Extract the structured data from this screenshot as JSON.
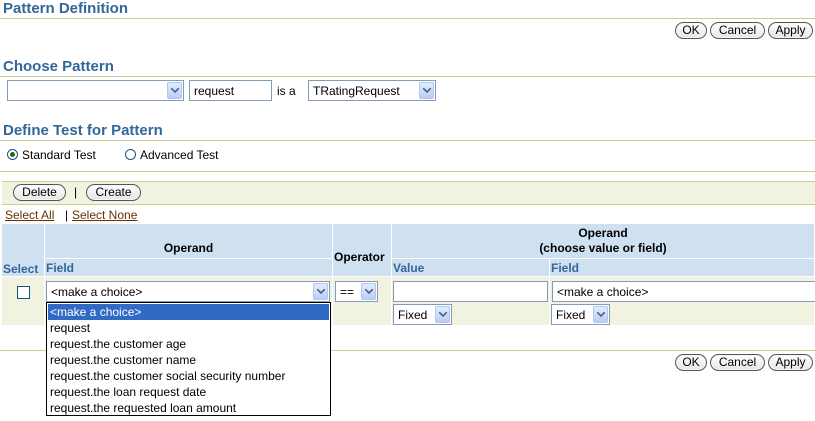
{
  "page_title": "Pattern Definition",
  "actions": {
    "ok": "OK",
    "cancel": "Cancel",
    "apply": "Apply"
  },
  "choose_pattern": {
    "heading": "Choose Pattern",
    "source_select_value": "",
    "variable_name": "request",
    "is_a_label": "is a",
    "type_select_value": "TRatingRequest"
  },
  "define_test": {
    "heading": "Define Test for Pattern",
    "standard_label": "Standard Test",
    "advanced_label": "Advanced Test",
    "selected_mode": "standard"
  },
  "toolbar": {
    "delete": "Delete",
    "separator": "|",
    "create": "Create"
  },
  "selection": {
    "select_all": "Select All",
    "separator": "|",
    "select_none": "Select None"
  },
  "table": {
    "headers": {
      "select": "Select",
      "operand": "Operand",
      "field": "Field",
      "operator": "Operator",
      "operand2_line1": "Operand",
      "operand2_line2": "(choose value or field)",
      "value": "Value",
      "field2": "Field"
    },
    "row": {
      "field_value": "<make a choice>",
      "operator_value": "==",
      "value_text": "",
      "value_mode": "Fixed",
      "field2_value": "<make a choice>",
      "field2_mode": "Fixed"
    }
  },
  "field_dropdown": {
    "options": [
      "<make a choice>",
      "request",
      "request.the customer age",
      "request.the customer name",
      "request.the customer social security number",
      "request.the loan request date",
      "request.the requested loan amount"
    ],
    "selected_index": 0
  },
  "colors": {
    "heading": "#336699",
    "table_header": "#cfe0f1",
    "panel": "#f2f2e1",
    "highlight": "#316ac5"
  }
}
